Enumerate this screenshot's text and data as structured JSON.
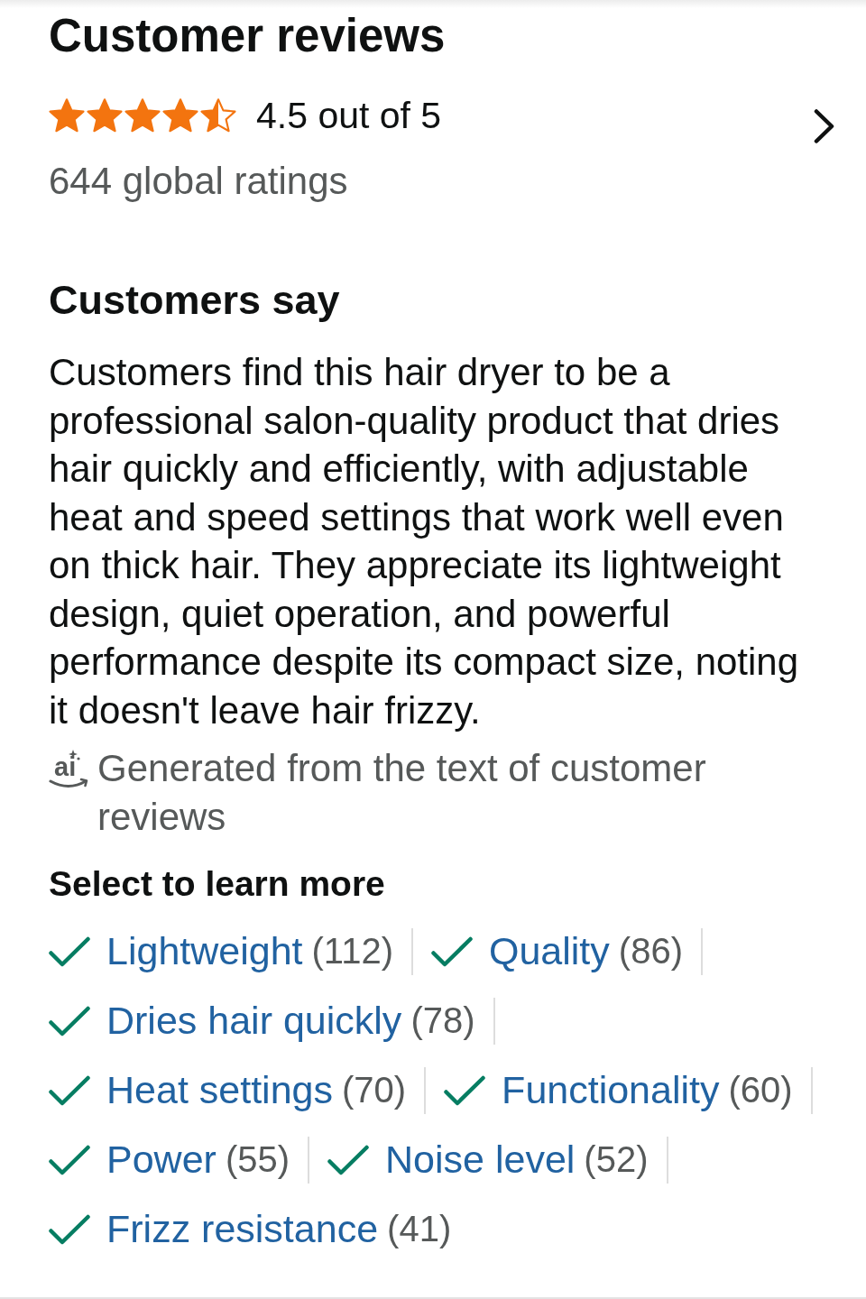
{
  "header": {
    "title": "Customer reviews",
    "stars": 4.5,
    "rating_text": "4.5 out of 5",
    "ratings_count": "644 global ratings"
  },
  "summary": {
    "title": "Customers say",
    "text": "Customers find this hair dryer to be a professional salon-quality product that dries hair quickly and efficiently, with adjustable heat and speed settings that work well even on thick hair. They appreciate its lightweight design, quiet operation, and powerful performance despite its compact size, noting it doesn't leave hair frizzy.",
    "ai_badge": "ai",
    "note": "Generated from the text of customer reviews"
  },
  "aspects": {
    "title": "Select to learn more",
    "items": [
      {
        "label": "Lightweight",
        "count": "(112)"
      },
      {
        "label": "Quality",
        "count": "(86)"
      },
      {
        "label": "Dries hair quickly",
        "count": "(78)"
      },
      {
        "label": "Heat settings",
        "count": "(70)"
      },
      {
        "label": "Functionality",
        "count": "(60)"
      },
      {
        "label": "Power",
        "count": "(55)"
      },
      {
        "label": "Noise level",
        "count": "(52)"
      },
      {
        "label": "Frizz resistance",
        "count": "(41)"
      }
    ]
  }
}
